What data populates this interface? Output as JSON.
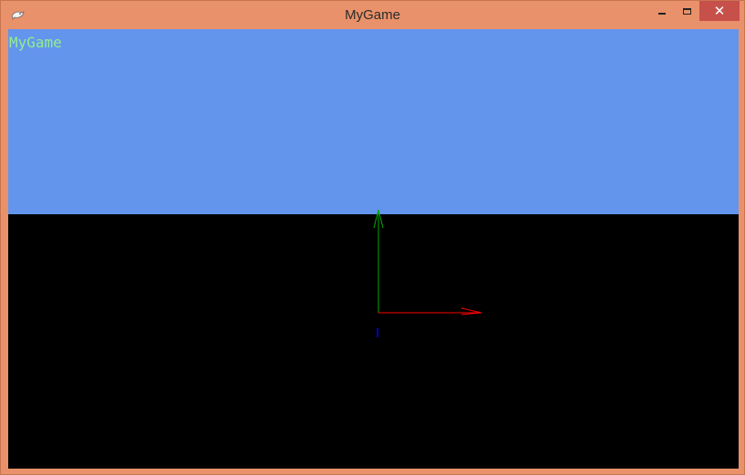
{
  "window": {
    "title": "MyGame",
    "icon": "dolphin-icon",
    "controls": {
      "minimize_icon": "minimize-icon",
      "maximize_icon": "maximize-icon",
      "close_glyph": "✕"
    },
    "frame_color": "#E9916A",
    "close_color": "#C7504B"
  },
  "scene": {
    "hud_text": "MyGame",
    "hud_color": "#90EE90",
    "sky_color": "#6495ED",
    "ground_color": "#000000",
    "axes": {
      "x_axis_color": "#FF0000",
      "y_axis_color": "#00AA00",
      "z_axis_color": "#0000FF"
    }
  }
}
